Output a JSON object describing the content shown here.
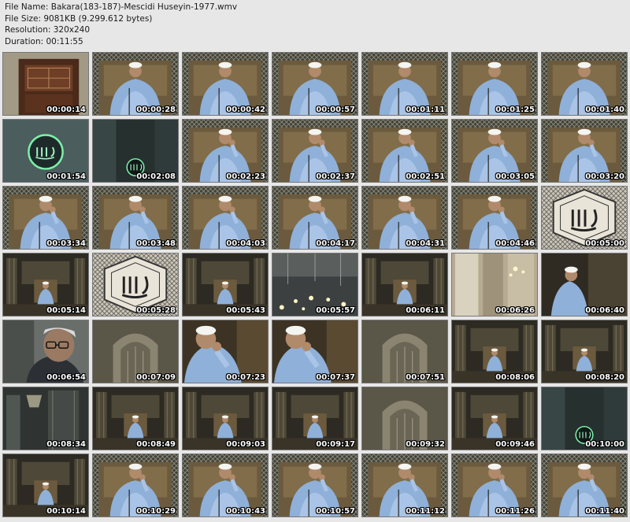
{
  "header": {
    "file_name": "File Name: Bakara(183-187)-Mescidi Huseyin-1977.wmv",
    "file_size": "File Size: 9081KB (9.299.612 bytes)",
    "resolution": "Resolution: 320x240",
    "duration": "Duration: 00:11:55"
  },
  "thumbnails": [
    {
      "time": "00:00:14",
      "scene": "window"
    },
    {
      "time": "00:00:28",
      "scene": "reciter"
    },
    {
      "time": "00:00:42",
      "scene": "reciter"
    },
    {
      "time": "00:00:57",
      "scene": "reciter"
    },
    {
      "time": "00:01:11",
      "scene": "reciter"
    },
    {
      "time": "00:01:25",
      "scene": "reciter"
    },
    {
      "time": "00:01:40",
      "scene": "reciter"
    },
    {
      "time": "00:01:54",
      "scene": "allah-green"
    },
    {
      "time": "00:02:08",
      "scene": "allah-small"
    },
    {
      "time": "00:02:23",
      "scene": "reciter-hand"
    },
    {
      "time": "00:02:37",
      "scene": "reciter-hand"
    },
    {
      "time": "00:02:51",
      "scene": "reciter-hand"
    },
    {
      "time": "00:03:05",
      "scene": "reciter-hand"
    },
    {
      "time": "00:03:20",
      "scene": "reciter-hand"
    },
    {
      "time": "00:03:34",
      "scene": "reciter-hand"
    },
    {
      "time": "00:03:48",
      "scene": "reciter-hand"
    },
    {
      "time": "00:04:03",
      "scene": "reciter-hand"
    },
    {
      "time": "00:04:17",
      "scene": "reciter-hand"
    },
    {
      "time": "00:04:31",
      "scene": "reciter-hand"
    },
    {
      "time": "00:04:46",
      "scene": "reciter-hand"
    },
    {
      "time": "00:05:00",
      "scene": "calligraphy"
    },
    {
      "time": "00:05:14",
      "scene": "mosque-wide"
    },
    {
      "time": "00:05:28",
      "scene": "calligraphy"
    },
    {
      "time": "00:05:43",
      "scene": "mosque-wide"
    },
    {
      "time": "00:05:57",
      "scene": "chandelier"
    },
    {
      "time": "00:06:11",
      "scene": "mosque-wide"
    },
    {
      "time": "00:06:26",
      "scene": "interior"
    },
    {
      "time": "00:06:40",
      "scene": "side-reciter"
    },
    {
      "time": "00:06:54",
      "scene": "man-glasses"
    },
    {
      "time": "00:07:09",
      "scene": "mihrab"
    },
    {
      "time": "00:07:23",
      "scene": "closeup"
    },
    {
      "time": "00:07:37",
      "scene": "closeup"
    },
    {
      "time": "00:07:51",
      "scene": "mihrab"
    },
    {
      "time": "00:08:06",
      "scene": "mosque-wide"
    },
    {
      "time": "00:08:20",
      "scene": "mosque-wide"
    },
    {
      "time": "00:08:34",
      "scene": "interior-dark"
    },
    {
      "time": "00:08:49",
      "scene": "mosque-wide"
    },
    {
      "time": "00:09:03",
      "scene": "mosque-wide"
    },
    {
      "time": "00:09:17",
      "scene": "mosque-wide"
    },
    {
      "time": "00:09:32",
      "scene": "mihrab"
    },
    {
      "time": "00:09:46",
      "scene": "mosque-wide"
    },
    {
      "time": "00:10:00",
      "scene": "allah-small"
    },
    {
      "time": "00:10:14",
      "scene": "mosque-wide"
    },
    {
      "time": "00:10:29",
      "scene": "reciter-hand"
    },
    {
      "time": "00:10:43",
      "scene": "reciter-hand"
    },
    {
      "time": "00:10:57",
      "scene": "reciter-hand"
    },
    {
      "time": "00:11:12",
      "scene": "reciter-hand"
    },
    {
      "time": "00:11:26",
      "scene": "reciter-hand"
    },
    {
      "time": "00:11:40",
      "scene": "reciter-hand"
    }
  ]
}
